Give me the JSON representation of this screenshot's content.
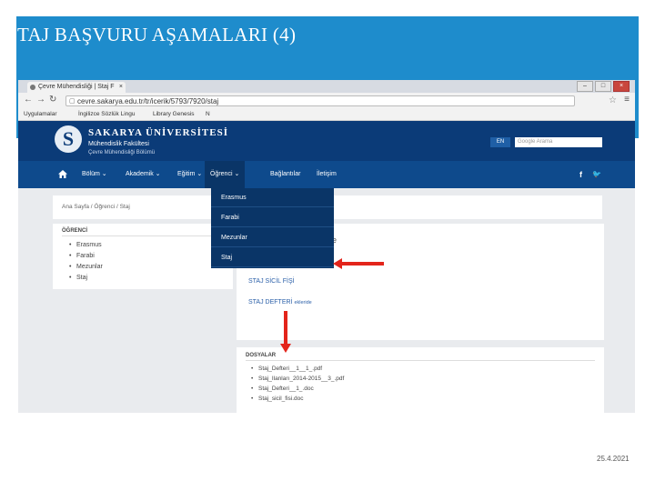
{
  "slide": {
    "title": "TAJ BAŞVURU AŞAMALARI (4)",
    "date": "25.4.2021"
  },
  "browser": {
    "tab_title": "Çevre Mühendisliği | Staj F",
    "url": "cevre.sakarya.edu.tr/tr/icerik/5793/7920/staj",
    "bookmarks": [
      "Uygulamalar",
      "İngilizce Sözlük Lingu",
      "Library Genesis",
      "N"
    ]
  },
  "site": {
    "university": "SAKARYA ÜNİVERSİTESİ",
    "faculty": "Mühendislik Fakültesi",
    "department": "Çevre Mühendisliği Bölümü",
    "lang_button": "EN",
    "search_placeholder": "Google Arama"
  },
  "nav": {
    "items": [
      "Bölüm",
      "Akademik",
      "Eğitim",
      "Öğrenci",
      "Bağlantılar",
      "İletişim"
    ],
    "active": "Öğrenci"
  },
  "breadcrumb": "Ana Sayfa  /  Öğrenci  /  Staj",
  "dropdown": {
    "items": [
      "Erasmus",
      "Farabi",
      "Mezunlar",
      "Staj"
    ]
  },
  "sidebar": {
    "title": "ÖĞRENCİ",
    "items": [
      "Erasmus",
      "Farabi",
      "Mezunlar",
      "Staj"
    ]
  },
  "main": {
    "heading_fragment": "e",
    "link1": "STAJ SİCİL FİŞİ",
    "link2": "STAJ DEFTERİ",
    "link2_suffix": "ekleride"
  },
  "files": {
    "title": "DOSYALAR",
    "items": [
      "Staj_Defteri__1__1_.pdf",
      "Staj_Ilanları_2014-2015__3_.pdf",
      "Staj_Defteri__1_.doc",
      "Staj_sicil_fisi.doc"
    ]
  },
  "colors": {
    "slide_header": "#1e8ccc",
    "site_header": "#0b3b78",
    "nav": "#0e4a8c",
    "dropdown": "#0a3567",
    "arrow": "#e3241b"
  }
}
